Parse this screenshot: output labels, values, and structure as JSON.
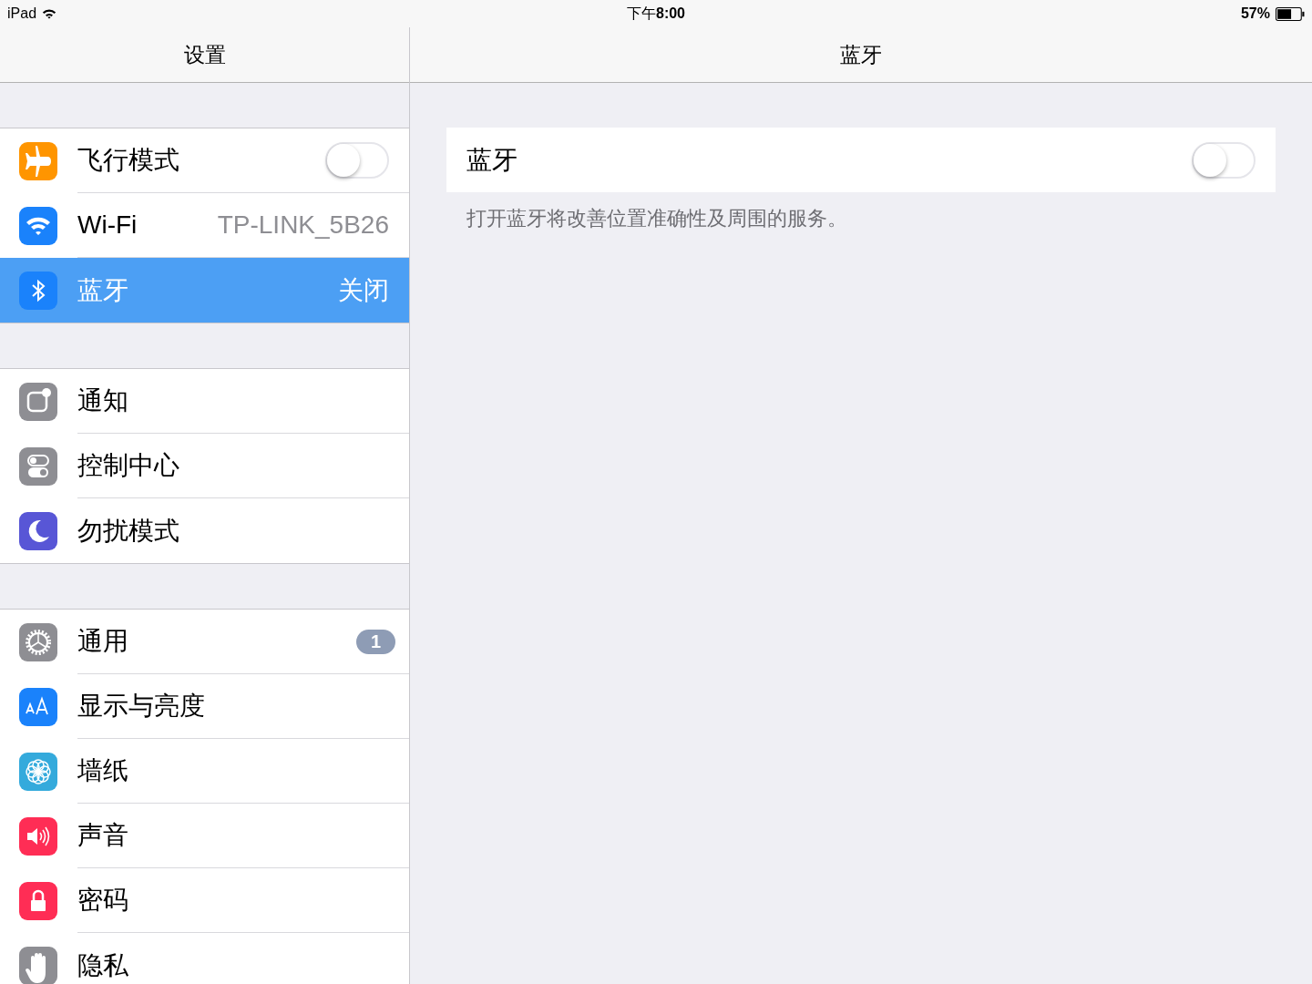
{
  "status_bar": {
    "device": "iPad",
    "time": "下午**8:00**",
    "battery": "57%"
  },
  "sidebar": {
    "title": "设置",
    "groups": [
      {
        "items": [
          {
            "label": "飞行模式",
            "kind": "airplane",
            "toggle": {
              "on": false
            },
            "selected": false
          },
          {
            "label": "Wi-Fi",
            "kind": "wifi",
            "value": "TP-LINK_5B26",
            "selected": false
          },
          {
            "label": "蓝牙",
            "kind": "bluetooth",
            "value": "关闭",
            "selected": true
          }
        ]
      },
      {
        "items": [
          {
            "label": "通知",
            "kind": "notifications",
            "selected": false
          },
          {
            "label": "控制中心",
            "kind": "control",
            "selected": false
          },
          {
            "label": "勿扰模式",
            "kind": "moon",
            "selected": false
          }
        ]
      },
      {
        "items": [
          {
            "label": "通用",
            "kind": "gear",
            "badge": "1",
            "selected": false
          },
          {
            "label": "显示与亮度",
            "kind": "text",
            "selected": false
          },
          {
            "label": "墙纸",
            "kind": "flower",
            "selected": false
          },
          {
            "label": "声音",
            "kind": "speaker",
            "selected": false
          },
          {
            "label": "密码",
            "kind": "lock",
            "selected": false
          },
          {
            "label": "隐私",
            "kind": "hand",
            "selected": false
          }
        ]
      }
    ]
  },
  "detail": {
    "title": "蓝牙",
    "setting": {
      "label": "蓝牙",
      "toggle": {
        "on": false
      }
    },
    "footer": "打开蓝牙将改善位置准确性及周围的服务。"
  }
}
